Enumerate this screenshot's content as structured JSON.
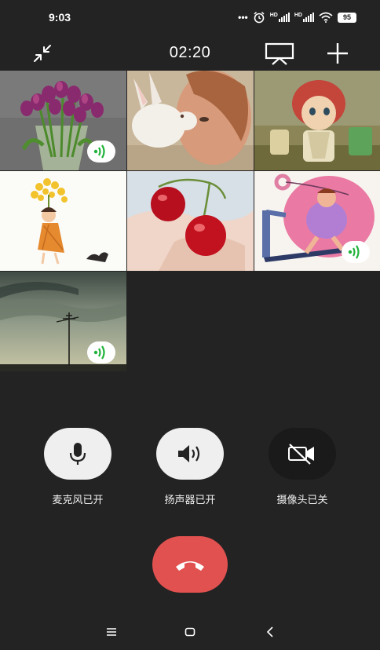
{
  "status_bar": {
    "time": "9:03",
    "dots": "•••",
    "hd1": "HD",
    "hd2": "HD",
    "battery": "95",
    "icons": [
      "alarm-icon",
      "signal-icon",
      "signal-icon",
      "wifi-icon",
      "battery-icon"
    ]
  },
  "header": {
    "timer": "02:20",
    "icons": [
      "minimize-icon",
      "screen-share-icon",
      "add-icon"
    ]
  },
  "participants": [
    {
      "name": "participant-tulips",
      "speaking": true
    },
    {
      "name": "participant-rabbit-girl",
      "speaking": false
    },
    {
      "name": "participant-cartoon-boy",
      "speaking": false
    },
    {
      "name": "participant-flower-girl",
      "speaking": false
    },
    {
      "name": "participant-cherries",
      "speaking": false
    },
    {
      "name": "participant-treadmill",
      "speaking": true
    },
    {
      "name": "participant-sky",
      "speaking": true
    }
  ],
  "controls": {
    "mic_label": "麦克风已开",
    "speaker_label": "扬声器已开",
    "camera_label": "摄像头已关"
  },
  "colors": {
    "background": "#232323",
    "hangup": "#e0514f",
    "control_on": "#efefef",
    "control_off": "#1a1a1a",
    "speaking_indicator": "#1fb33a"
  },
  "navbar": {
    "icons": [
      "menu-icon",
      "home-icon",
      "back-icon"
    ]
  }
}
